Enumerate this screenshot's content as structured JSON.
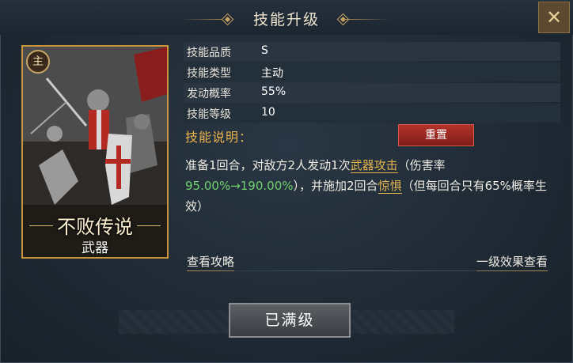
{
  "header": {
    "title": "技能升级"
  },
  "card": {
    "badge": "主",
    "name": "不败传说",
    "type": "武器"
  },
  "info": [
    {
      "label": "技能品质",
      "value": "S"
    },
    {
      "label": "技能类型",
      "value": "主动"
    },
    {
      "label": "发动概率",
      "value": "55%"
    },
    {
      "label": "技能等级",
      "value": "10"
    }
  ],
  "description": {
    "title": "技能说明：",
    "reset_label": "重置",
    "part1": "准备1回合，对敌方2人发动1次",
    "link1": "武器攻击",
    "part2": "（伤害率",
    "green": "95.00%→190.00%",
    "part3": "），并施加2回合",
    "link2": "惊惧",
    "part4": "（但每回合只有65%概率生效）"
  },
  "links": {
    "left": "查看攻略",
    "right": "一级效果查看"
  },
  "button": {
    "label": "已满级"
  },
  "colors": {
    "accent_gold": "#e6b24c",
    "highlight_green": "#6fd06f",
    "reset_red": "#b3332a"
  }
}
